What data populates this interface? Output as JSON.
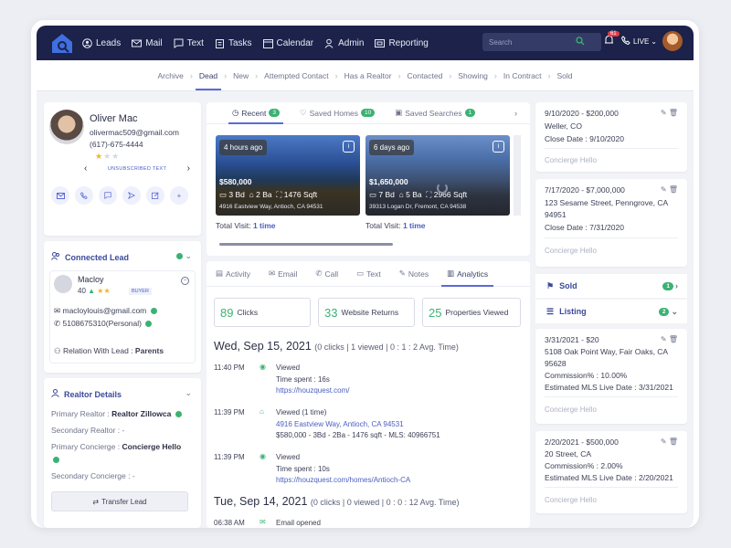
{
  "nav": {
    "items": [
      {
        "icon": "person-circle-icon",
        "label": "Leads"
      },
      {
        "icon": "mail-icon",
        "label": "Mail"
      },
      {
        "icon": "chat-icon",
        "label": "Text"
      },
      {
        "icon": "clipboard-icon",
        "label": "Tasks"
      },
      {
        "icon": "calendar-icon",
        "label": "Calendar"
      },
      {
        "icon": "admin-icon",
        "label": "Admin"
      },
      {
        "icon": "report-icon",
        "label": "Reporting"
      }
    ],
    "search_placeholder": "Search",
    "notifications": "61",
    "live": "LIVE"
  },
  "stages": [
    "Archive",
    "Dead",
    "New",
    "Attempted Contact",
    "Has a Realtor",
    "Contacted",
    "Showing",
    "In Contract",
    "Sold"
  ],
  "active_stage": "Dead",
  "lead": {
    "name": "Oliver Mac",
    "email": "olivermac509@gmail.com",
    "phone": "(617)-675-4444",
    "rating": 1,
    "status": "UNSUBSCRIBED TEXT"
  },
  "connected": {
    "title": "Connected Lead",
    "name": "Macloy",
    "age": "40",
    "tag": "BUYER",
    "email": "macloylouis@gmail.com",
    "phone": "5108675310(Personal)",
    "relation_label": "Relation With Lead :",
    "relation": "Parents"
  },
  "realtor": {
    "title": "Realtor Details",
    "primary_realtor_label": "Primary Realtor :",
    "primary_realtor": "Realtor Zillowca",
    "secondary_realtor_label": "Secondary Realtor :",
    "secondary_realtor": "-",
    "primary_concierge_label": "Primary Concierge :",
    "primary_concierge": "Concierge Hello",
    "secondary_concierge_label": "Secondary Concierge :",
    "secondary_concierge": "-",
    "transfer": "Transfer Lead"
  },
  "homes_tabs": [
    {
      "label": "Recent",
      "count": "3"
    },
    {
      "label": "Saved Homes",
      "count": "10"
    },
    {
      "label": "Saved Searches",
      "count": "1"
    }
  ],
  "properties": [
    {
      "time": "4 hours ago",
      "price": "$580,000",
      "bd": "3 Bd",
      "ba": "2 Ba",
      "sqft": "1476 Sqft",
      "address": "4916 Eastview Way, Antioch, CA 94531",
      "visit_label": "Total Visit:",
      "visit": "1 time"
    },
    {
      "time": "6 days ago",
      "price": "$1,650,000",
      "bd": "7 Bd",
      "ba": "5 Ba",
      "sqft": "2966 Sqft",
      "address": "39313 Logan Dr, Fremont, CA 94538",
      "visit_label": "Total Visit:",
      "visit": "1 time"
    }
  ],
  "activity_tabs": [
    "Activity",
    "Email",
    "Call",
    "Text",
    "Notes",
    "Analytics"
  ],
  "metrics": [
    {
      "value": "89",
      "label": "Clicks"
    },
    {
      "value": "33",
      "label": "Website Returns"
    },
    {
      "value": "25",
      "label": "Properties Viewed"
    }
  ],
  "day1": {
    "date": "Wed, Sep 15, 2021",
    "summary": "(0 clicks | 1 viewed | 0 : 1 : 2 Avg. Time)"
  },
  "events": [
    {
      "time": "11:40 PM",
      "title": "Viewed",
      "line2": "Time spent : 16s",
      "link": "https://houzquest.com/"
    },
    {
      "time": "11:39 PM",
      "title": "Viewed (1 time)",
      "link": "4916 Eastview Way, Antioch, CA 94531",
      "line3": "$580,000 - 3Bd - 2Ba - 1476 sqft - MLS: 40966751"
    },
    {
      "time": "11:39 PM",
      "title": "Viewed",
      "line2": "Time spent : 10s",
      "link": "https://houzquest.com/homes/Antioch-CA"
    }
  ],
  "day2": {
    "date": "Tue, Sep 14, 2021",
    "summary": "(0 clicks | 0 viewed | 0 : 0 : 12 Avg. Time)"
  },
  "event4": {
    "time": "06:38 AM",
    "title": "Email opened"
  },
  "transactions": [
    {
      "range": "9/10/2020 - $200,000",
      "addr1": "Weller, CO",
      "date": "Close Date : 9/10/2020",
      "concierge": "Concierge Hello"
    },
    {
      "range": "7/17/2020 - $7,000,000",
      "addr1": "123 Sesame Street, Penngrove, CA",
      "addr2": "94951",
      "date": "Close Date : 7/31/2020",
      "concierge": "Concierge Hello"
    }
  ],
  "sold": {
    "title": "Sold",
    "count": "1"
  },
  "listing": {
    "title": "Listing",
    "count": "2"
  },
  "listings": [
    {
      "range": "3/31/2021 - $20",
      "addr1": "5108 Oak Point Way, Fair Oaks, CA",
      "addr2": "95628",
      "commission": "Commission% : 10.00%",
      "live": "Estimated MLS Live Date : 3/31/2021",
      "concierge": "Concierge Hello"
    },
    {
      "range": "2/20/2021 - $500,000",
      "addr1": "20 Street, CA",
      "commission": "Commission% : 2.00%",
      "live": "Estimated MLS Live Date : 2/20/2021",
      "concierge": "Concierge Hello"
    }
  ]
}
